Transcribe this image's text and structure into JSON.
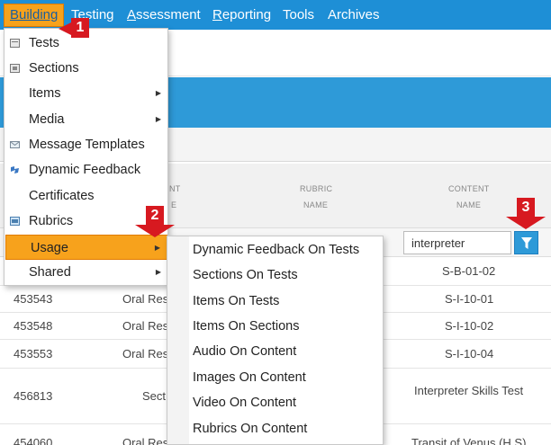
{
  "nav": {
    "building": "Building",
    "testing": "Testing",
    "assessment": "Assessment",
    "reporting": "Reporting",
    "tools": "Tools",
    "archives": "Archives"
  },
  "table": {
    "headers": {
      "col2_line1": "NT",
      "col2_line2": "E",
      "rubric_line1": "RUBRIC",
      "rubric_line2": "NAME",
      "content_line1": "CONTENT",
      "content_line2": "NAME"
    },
    "filter_value": "interpreter",
    "rows": [
      {
        "id": "",
        "type": "",
        "content": "S-B-01-02"
      },
      {
        "id": "453543",
        "type": "Oral Res",
        "content": "S-I-10-01"
      },
      {
        "id": "453548",
        "type": "Oral Res",
        "content": "S-I-10-02"
      },
      {
        "id": "453553",
        "type": "Oral Res",
        "content": "S-I-10-04"
      },
      {
        "id": "456813",
        "type": "Sect",
        "content": "Interpreter Skills Test"
      },
      {
        "id": "454060",
        "type": "Oral Res",
        "content": "Transit of Venus (H.S)"
      }
    ]
  },
  "menu": {
    "items": [
      {
        "label": "Tests",
        "icon": "test-icon"
      },
      {
        "label": "Sections",
        "icon": "section-icon"
      },
      {
        "label": "Items",
        "icon": ""
      },
      {
        "label": "Media",
        "icon": ""
      },
      {
        "label": "Message Templates",
        "icon": "envelope-icon"
      },
      {
        "label": "Dynamic Feedback",
        "icon": "puzzle-icon"
      },
      {
        "label": "Certificates",
        "icon": ""
      },
      {
        "label": "Rubrics",
        "icon": "rubric-icon"
      },
      {
        "label": "Usage",
        "icon": ""
      },
      {
        "label": "Shared",
        "icon": ""
      }
    ]
  },
  "submenu": {
    "items": [
      "Dynamic Feedback On Tests",
      "Sections On Tests",
      "Items On Tests",
      "Items On Sections",
      "Audio On Content",
      "Images On Content",
      "Video On Content",
      "Rubrics On Content"
    ]
  },
  "callouts": [
    "1",
    "2",
    "3"
  ],
  "colors": {
    "nav_blue": "#1e8fd6",
    "highlight_orange": "#f7a21c",
    "callout_red": "#d71920"
  }
}
